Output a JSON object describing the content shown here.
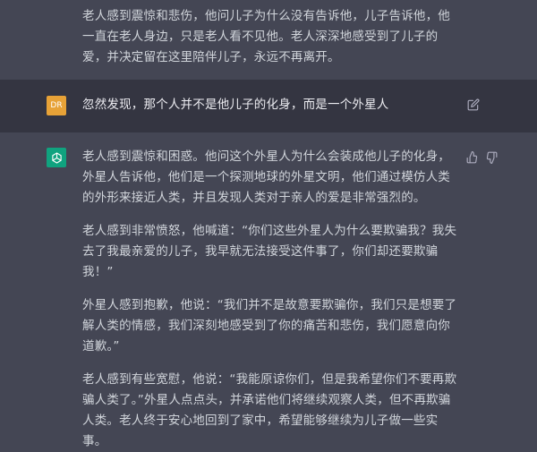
{
  "conversation": {
    "assistant_top": {
      "paragraph": "老人感到震惊和悲伤，他问儿子为什么没有告诉他，儿子告诉他，他一直在老人身边，只是老人看不见他。老人深深地感受到了儿子的爱，并决定留在这里陪伴儿子，永远不再离开。"
    },
    "user": {
      "avatar_initials": "DR",
      "message": "忽然发现，那个人并不是他儿子的化身，而是一个外星人"
    },
    "assistant": {
      "paragraphs": [
        "老人感到震惊和困惑。他问这个外星人为什么会装成他儿子的化身，外星人告诉他，他们是一个探测地球的外星文明，他们通过模仿人类的外形来接近人类，并且发现人类对于亲人的爱是非常强烈的。",
        "老人感到非常愤怒，他喊道：“你们这些外星人为什么要欺骗我？我失去了我最亲爱的儿子，我早就无法接受这件事了，你们却还要欺骗我！”",
        "外星人感到抱歉，他说：“我们并不是故意要欺骗你，我们只是想要了解人类的情感，我们深刻地感受到了你的痛苦和悲伤，我们愿意向你道歉。”",
        "老人感到有些宽慰，他说：“我能原谅你们，但是我希望你们不要再欺骗人类了。”外星人点点头，并承诺他们将继续观察人类，但不再欺骗人类。老人终于安心地回到了家中，希望能够继续为儿子做一些实事。"
      ]
    }
  },
  "colors": {
    "assistant_bg": "#444654",
    "user_bg": "#343541",
    "text": "#d1d5db",
    "user_avatar": "#e7a237",
    "gpt_avatar": "#10a37f"
  },
  "icons": [
    "edit-icon",
    "openai-logo-icon",
    "thumbs-up-icon",
    "thumbs-down-icon"
  ]
}
